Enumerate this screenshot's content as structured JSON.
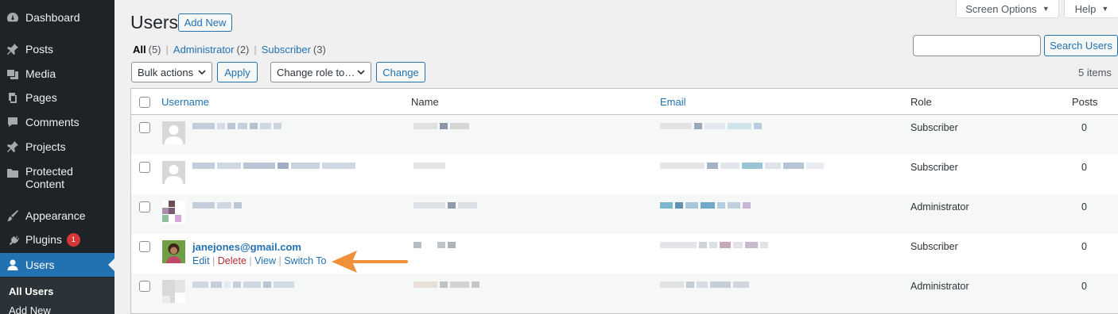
{
  "sidebar": {
    "items": [
      {
        "label": "Dashboard",
        "icon": "dashboard-icon"
      },
      {
        "label": "Posts",
        "icon": "pin-icon"
      },
      {
        "label": "Media",
        "icon": "media-icon"
      },
      {
        "label": "Pages",
        "icon": "pages-icon"
      },
      {
        "label": "Comments",
        "icon": "comment-icon"
      },
      {
        "label": "Projects",
        "icon": "pin-icon"
      },
      {
        "label": "Protected Content",
        "icon": "folder-icon"
      },
      {
        "label": "Appearance",
        "icon": "brush-icon"
      },
      {
        "label": "Plugins",
        "icon": "plug-icon",
        "badge": "1"
      },
      {
        "label": "Users",
        "icon": "user-icon"
      }
    ],
    "submenu": [
      "All Users",
      "Add New"
    ]
  },
  "header": {
    "title": "Users",
    "add_new": "Add New",
    "screen_options": "Screen Options",
    "help": "Help"
  },
  "filters": {
    "all": "All",
    "all_count": "(5)",
    "administrator": "Administrator",
    "administrator_count": "(2)",
    "subscriber": "Subscriber",
    "subscriber_count": "(3)"
  },
  "search": {
    "button": "Search Users",
    "value": ""
  },
  "toolbar": {
    "bulk_actions": "Bulk actions",
    "apply": "Apply",
    "change_role": "Change role to…",
    "change": "Change",
    "items_count": "5 items"
  },
  "table": {
    "columns": [
      "Username",
      "Name",
      "Email",
      "Role",
      "Posts"
    ],
    "rows": [
      {
        "username": "",
        "role": "Subscriber",
        "posts": "0"
      },
      {
        "username": "",
        "role": "Subscriber",
        "posts": "0"
      },
      {
        "username": "",
        "role": "Administrator",
        "posts": "0"
      },
      {
        "username": "janejones@gmail.com",
        "role": "Subscriber",
        "posts": "0",
        "actions": [
          "Edit",
          "Delete",
          "View",
          "Switch To"
        ]
      },
      {
        "username": "",
        "role": "Administrator",
        "posts": "0"
      }
    ]
  },
  "colors": {
    "accent": "#2271b1",
    "sidebar": "#1d2327",
    "annotation_arrow": "#f0913a",
    "delete": "#b32d2e"
  }
}
